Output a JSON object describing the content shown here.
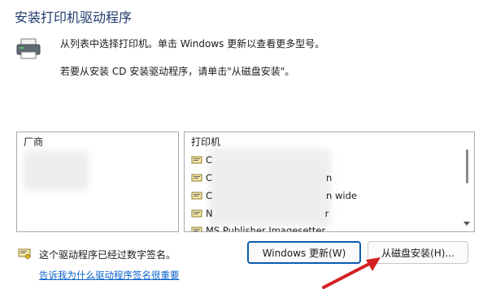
{
  "dialog": {
    "title": "安装打印机驱动程序",
    "description_line1": "从列表中选择打印机。单击 Windows 更新以查看更多型号。",
    "description_line2": "若要从安装 CD 安装驱动程序，请单击\"从磁盘安装\"。"
  },
  "manufacturer_list": {
    "header": "厂商",
    "items": []
  },
  "printer_list": {
    "header": "打印机",
    "items": [
      {
        "label": "C",
        "tail": ""
      },
      {
        "label": "C",
        "tail": "n"
      },
      {
        "label": "C",
        "tail": "n wide"
      },
      {
        "label": "N",
        "tail": "r"
      },
      {
        "label": "MS Publisher Imagesetter",
        "tail": ""
      }
    ]
  },
  "signature": {
    "status_text": "这个驱动程序已经过数字签名。",
    "link_text": "告诉我为什么驱动程序签名很重要"
  },
  "buttons": {
    "windows_update": "Windows 更新(W)",
    "have_disk": "从磁盘安装(H)..."
  },
  "icons": {
    "printer": "printer-icon",
    "driver": "printer-driver-icon",
    "signature": "signed-certificate-icon"
  },
  "colors": {
    "title": "#1f3a6b",
    "link": "#0a62c9",
    "focus_border": "#0b5cad",
    "annotation_arrow": "#d42020"
  }
}
